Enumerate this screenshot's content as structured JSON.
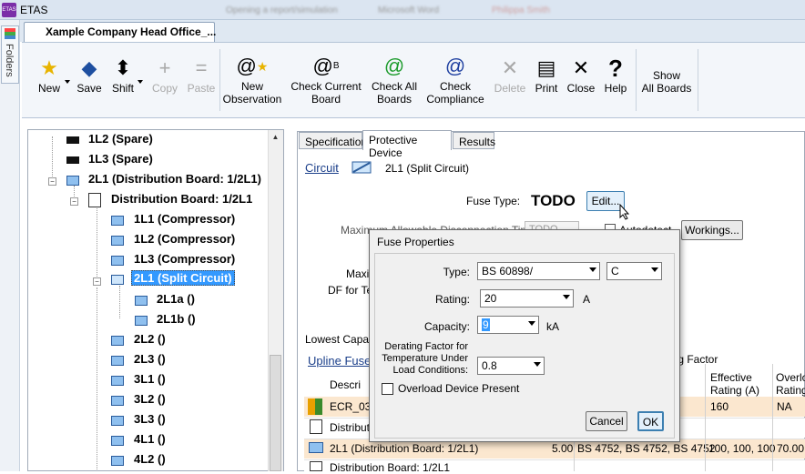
{
  "app": {
    "title": "ETAS",
    "icon_text": "ETAS"
  },
  "blurred_title_fragments": [
    "Opening a report/simulation",
    "Microsoft Word",
    "Philippa Smith"
  ],
  "folders_label": "Folders",
  "doc_tab": {
    "label": "Xample Company Head Office_..."
  },
  "ribbon": {
    "new": "New",
    "save": "Save",
    "shift": "Shift",
    "copy": "Copy",
    "paste": "Paste",
    "new_observation_1": "New",
    "new_observation_2": "Observation",
    "check_current_1": "Check Current",
    "check_current_2": "Board",
    "check_all_1": "Check All",
    "check_all_2": "Boards",
    "check_compliance_1": "Check",
    "check_compliance_2": "Compliance",
    "delete": "Delete",
    "print": "Print",
    "close": "Close",
    "help": "Help",
    "show_all_1": "Show",
    "show_all_2": "All Boards"
  },
  "tree": {
    "items": [
      "1L2 (Spare)",
      "1L3 (Spare)",
      "2L1 (Distribution Board: 1/2L1)",
      "Distribution Board: 1/2L1",
      "1L1 (Compressor)",
      "1L2 (Compressor)",
      "1L3 (Compressor)",
      "2L1 (Split Circuit)",
      "2L1a ()",
      "2L1b ()",
      "2L2 ()",
      "2L3 ()",
      "3L1 ()",
      "3L2 ()",
      "3L3 ()",
      "4L1 ()",
      "4L2 ()"
    ]
  },
  "panel_tabs": [
    "Specification",
    "Protective Device",
    "Results"
  ],
  "circuit": {
    "label": "Circuit",
    "value": "2L1 (Split Circuit)"
  },
  "fuse_type": {
    "label": "Fuse Type:",
    "value": "TODO",
    "edit": "Edit..."
  },
  "partial": {
    "max_allowable": "Maximum Allowable Disconnection Time:",
    "max_allowable_value": "TODO",
    "autodetect": "Autodetect",
    "workings": "Workings...",
    "maxi": "Maxi",
    "df_for_te": "DF for Te",
    "lowest_capacity": "Lowest Capacit",
    "derating_factor": "ing Factor",
    "upline": "Upline Fuse",
    "descri": "Descri"
  },
  "table": {
    "headers": [
      "Effective Rating (A)",
      "Overlo Rating"
    ],
    "rows": [
      {
        "desc": "ECR_03-",
        "eff": "160",
        "over": "NA"
      },
      {
        "desc": "Distributio",
        "eff": "",
        "over": ""
      },
      {
        "desc": "2L1 (Distribution Board: 1/2L1)",
        "a": "5.00",
        "b": "BS 4752, BS 4752, BS 4752",
        "eff": "100, 100, 100",
        "over": "70.00,"
      },
      {
        "desc": "Distribution Board: 1/2L1",
        "eff": "",
        "over": ""
      }
    ]
  },
  "dialog": {
    "title": "Fuse Properties",
    "type_label": "Type:",
    "type_value": "BS 60898/",
    "type2_value": "C",
    "rating_label": "Rating:",
    "rating_value": "20",
    "rating_unit": "A",
    "capacity_label": "Capacity:",
    "capacity_value": "9",
    "capacity_unit": "kA",
    "derating_1": "Derating Factor for",
    "derating_2": "Temperature Under",
    "derating_3": "Load Conditions:",
    "derating_value": "0.8",
    "overload_label": "Overload Device Present",
    "cancel": "Cancel",
    "ok": "OK"
  }
}
